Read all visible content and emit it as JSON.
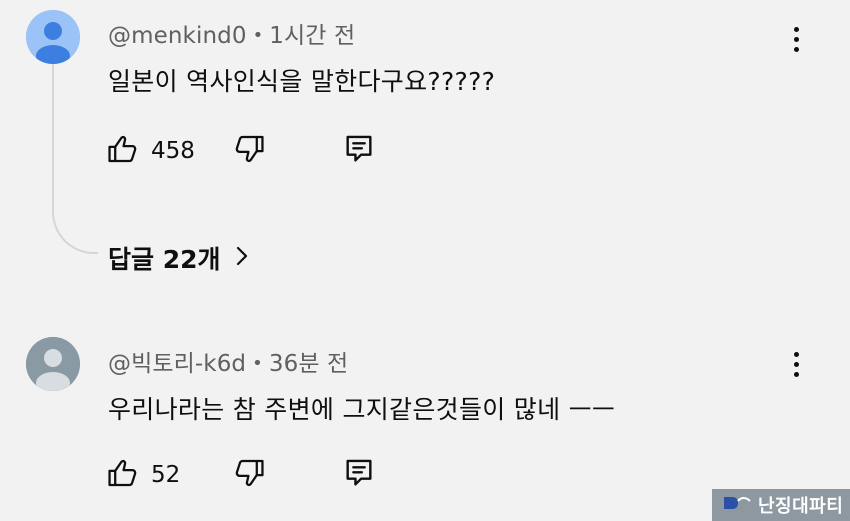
{
  "comments": [
    {
      "username": "@menkind0",
      "time": "1시간 전",
      "text": "일본이 역사인식을 말한다구요?????",
      "likes": "458",
      "avatar_color": "#9cc3f7",
      "replies_label": "답글 22개"
    },
    {
      "username": "@빅토리-k6d",
      "time": "36분 전",
      "text": "우리나라는 참 주변에 그지같은것들이 많네 ㅡㅡ",
      "likes": "52",
      "avatar_color": "#8a9aa4"
    }
  ],
  "meta_separator": "•",
  "icons": {
    "like": "thumbs-up-icon",
    "dislike": "thumbs-down-icon",
    "reply": "comment-reply-icon",
    "more": "more-vertical-icon",
    "chevron": "chevron-right-icon"
  },
  "watermark": "난징대파티"
}
